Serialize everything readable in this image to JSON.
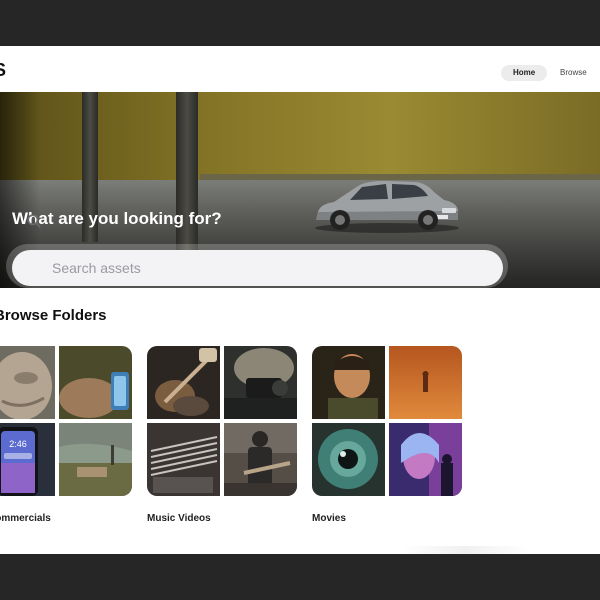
{
  "nav": {
    "logo": "S",
    "home_label": "Home",
    "browse_label": "Browse"
  },
  "hero": {
    "title": "What are you looking for?",
    "search_placeholder": "Search assets"
  },
  "browse": {
    "title": "Browse Folders",
    "folders": [
      {
        "label": "Commercials"
      },
      {
        "label": "Music Videos"
      },
      {
        "label": "Movies"
      }
    ]
  },
  "phone_clock": "2:46",
  "icons": {
    "search": "search-icon"
  },
  "colors": {
    "nav_active_bg": "#ececec",
    "search_bg": "#f3f3f5",
    "text_dark": "#111111",
    "outer_bg": "#262626"
  }
}
